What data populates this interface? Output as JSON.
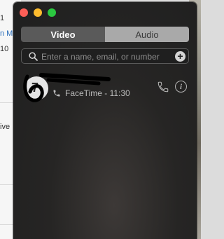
{
  "background_window": {
    "fragments": [
      {
        "text": "1",
        "link": false
      },
      {
        "text": "n M",
        "link": true
      },
      {
        "text": "10",
        "link": false
      },
      {
        "text": "ive",
        "link": false
      }
    ]
  },
  "facetime": {
    "tabs": [
      {
        "label": "Video",
        "active": true
      },
      {
        "label": "Audio",
        "active": false
      }
    ],
    "search": {
      "placeholder": "Enter a name, email, or number",
      "value": "",
      "add_icon": "plus-circle-icon"
    },
    "recents": [
      {
        "avatar_letter": "7",
        "name": "",
        "name_redacted": true,
        "meta": "FaceTime - 11:30",
        "meta_icon": "phone-icon",
        "call_icon": "phone-icon",
        "info_label": "i"
      }
    ]
  },
  "colors": {
    "close": "#fc5f57",
    "minimize": "#fdbc2e",
    "zoom": "#2bc840",
    "active_tab": "#5a5a5a",
    "inactive_tab": "#a9a9a9"
  }
}
